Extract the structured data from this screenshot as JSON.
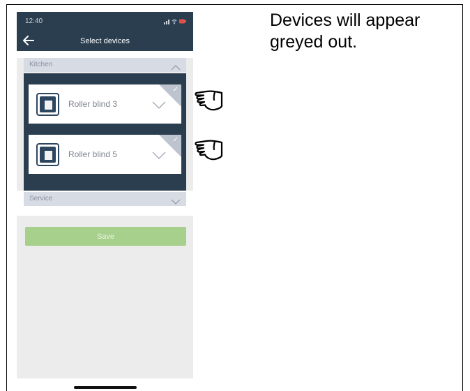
{
  "caption": "Devices will appear greyed out.",
  "status_bar": {
    "time": "12:40",
    "icons": "all-signal wifi battery"
  },
  "header": {
    "title": "Select devices"
  },
  "sections": {
    "kitchen": {
      "label": "Kitchen",
      "expanded": true
    },
    "service": {
      "label": "Service",
      "expanded": false
    }
  },
  "devices": [
    {
      "name": "Roller blind 3",
      "selected": true,
      "greyed_out": true
    },
    {
      "name": "Roller blind 5",
      "selected": true,
      "greyed_out": true
    }
  ],
  "save_label": "Save",
  "icons": [
    "back-arrow-icon",
    "chevron-up-icon",
    "chevron-down-icon",
    "roller-blind-icon",
    "check-icon",
    "pointing-hand-icon"
  ],
  "colors": {
    "header_bg": "#2b3e50",
    "section_bar": "#d7dbe4",
    "save_button": "#a6d08c",
    "check_corner": "#bdc4cf"
  }
}
